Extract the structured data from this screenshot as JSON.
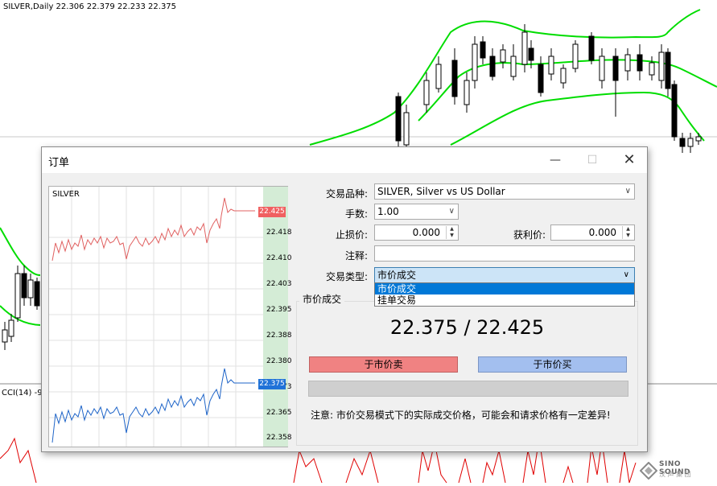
{
  "chart_header": "SILVER,Daily  22.306 22.379 22.233 22.375",
  "cci_label": "CCI(14) -99",
  "dialog": {
    "title": "订单",
    "symbol_label": "交易品种:",
    "symbol_value": "SILVER, Silver vs US Dollar",
    "volume_label": "手数:",
    "volume_value": "1.00",
    "sl_label": "止损价:",
    "sl_value": "0.000",
    "tp_label": "获利价:",
    "tp_value": "0.000",
    "comment_label": "注释:",
    "comment_value": "",
    "type_label": "交易类型:",
    "type_value": "市价成交",
    "type_options": [
      "市价成交",
      "挂单交易"
    ],
    "group_title": "市价成交",
    "quote": "22.375 / 22.425",
    "sell_label": "于市价卖",
    "buy_label": "于市价买",
    "notice": "注意: 市价交易模式下的实际成交价格，可能会和请求价格有一定差异!"
  },
  "mini_chart": {
    "symbol": "SILVER",
    "ask_tag": "22.425",
    "bid_tag": "22.375",
    "ticks": [
      "22.418",
      "22.410",
      "22.403",
      "22.395",
      "22.388",
      "22.380",
      "22.373",
      "22.365",
      "22.358"
    ]
  },
  "watermark": {
    "brand": "SINO SOUND",
    "sub": "汉 声 集 团"
  },
  "colors": {
    "ask_line": "#e06060",
    "bid_line": "#1e64c8",
    "band": "#00dd00",
    "sell_btn": "#f08282",
    "buy_btn": "#a3bfef",
    "price_panel": "#d4ecd6"
  }
}
